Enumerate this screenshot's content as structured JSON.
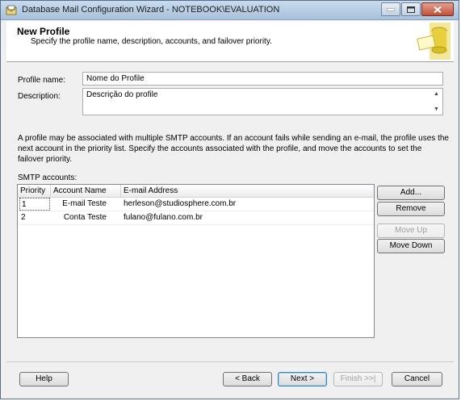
{
  "window": {
    "title": "Database Mail Configuration Wizard - NOTEBOOK\\EVALUATION"
  },
  "header": {
    "title": "New Profile",
    "subtitle": "Specify the profile name, description, accounts, and failover priority."
  },
  "form": {
    "profile_name_label": "Profile name:",
    "profile_name_value": "Nome do Profile",
    "description_label": "Description:",
    "description_value": "Descrição do profile"
  },
  "info_text": "A profile may be associated with multiple SMTP accounts. If an account fails while sending an e-mail, the profile uses the next account in the priority list. Specify the accounts associated with the profile, and move the accounts to set the failover priority.",
  "smtp": {
    "label": "SMTP accounts:",
    "columns": [
      "Priority",
      "Account Name",
      "E-mail Address"
    ],
    "rows": [
      {
        "priority": "1",
        "account": "E-mail Teste",
        "email": "herleson@studiosphere.com.br"
      },
      {
        "priority": "2",
        "account": "Conta Teste",
        "email": "fulano@fulano.com.br"
      }
    ]
  },
  "side_buttons": {
    "add": "Add...",
    "remove": "Remove",
    "move_up": "Move Up",
    "move_down": "Move Down"
  },
  "footer_buttons": {
    "help": "Help",
    "back": "< Back",
    "next": "Next >",
    "finish": "Finish >>|",
    "cancel": "Cancel"
  },
  "icons": {
    "app": "database-mail-icon",
    "header_art": "wizard-banner-icon"
  }
}
